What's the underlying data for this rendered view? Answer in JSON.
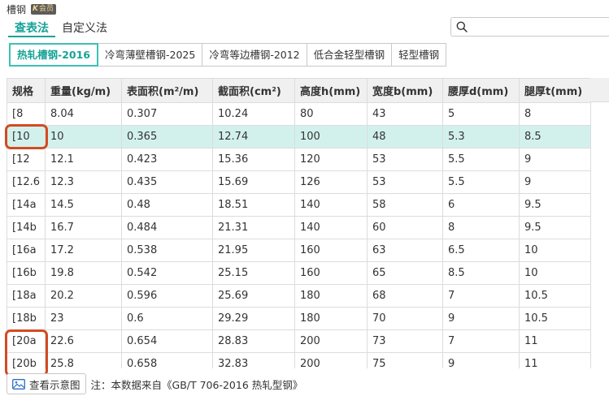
{
  "app": {
    "title": "槽钢",
    "vip_badge": "会员"
  },
  "mode_tabs": [
    {
      "label": "查表法",
      "active": true
    },
    {
      "label": "自定义法",
      "active": false
    }
  ],
  "search": {
    "placeholder": ""
  },
  "standard_tabs": [
    {
      "label": "热轧槽钢-2016",
      "active": true
    },
    {
      "label": "冷弯薄壁槽钢-2025",
      "active": false
    },
    {
      "label": "冷弯等边槽钢-2012",
      "active": false
    },
    {
      "label": "低合金轻型槽钢",
      "active": false
    },
    {
      "label": "轻型槽钢",
      "active": false
    }
  ],
  "table": {
    "headers": [
      "规格",
      "重量(kg/m)",
      "表面积(m²/m)",
      "截面积(cm²)",
      "高度h(mm)",
      "宽度b(mm)",
      "腰厚d(mm)",
      "腿厚t(mm)"
    ],
    "selected_row": 1,
    "rows": [
      [
        "[8",
        "8.04",
        "0.307",
        "10.24",
        "80",
        "43",
        "5",
        "8"
      ],
      [
        "[10",
        "10",
        "0.365",
        "12.74",
        "100",
        "48",
        "5.3",
        "8.5"
      ],
      [
        "[12",
        "12.1",
        "0.423",
        "15.36",
        "120",
        "53",
        "5.5",
        "9"
      ],
      [
        "[12.6",
        "12.3",
        "0.435",
        "15.69",
        "126",
        "53",
        "5.5",
        "9"
      ],
      [
        "[14a",
        "14.5",
        "0.48",
        "18.51",
        "140",
        "58",
        "6",
        "9.5"
      ],
      [
        "[14b",
        "16.7",
        "0.484",
        "21.31",
        "140",
        "60",
        "8",
        "9.5"
      ],
      [
        "[16a",
        "17.2",
        "0.538",
        "21.95",
        "160",
        "63",
        "6.5",
        "10"
      ],
      [
        "[16b",
        "19.8",
        "0.542",
        "25.15",
        "160",
        "65",
        "8.5",
        "10"
      ],
      [
        "[18a",
        "20.2",
        "0.596",
        "25.69",
        "180",
        "68",
        "7",
        "10.5"
      ],
      [
        "[18b",
        "23",
        "0.6",
        "29.29",
        "180",
        "70",
        "9",
        "10.5"
      ],
      [
        "[20a",
        "22.6",
        "0.654",
        "28.83",
        "200",
        "73",
        "7",
        "11"
      ],
      [
        "[20b",
        "25.8",
        "0.658",
        "32.83",
        "200",
        "75",
        "9",
        "11"
      ]
    ]
  },
  "footer": {
    "diagram_button": "查看示意图",
    "note": "注：本数据来自《GB/T 706-2016 热轧型钢》"
  },
  "colors": {
    "accent": "#17a397",
    "selected_row": "#d3f1ec",
    "highlight": "#d34b22"
  }
}
